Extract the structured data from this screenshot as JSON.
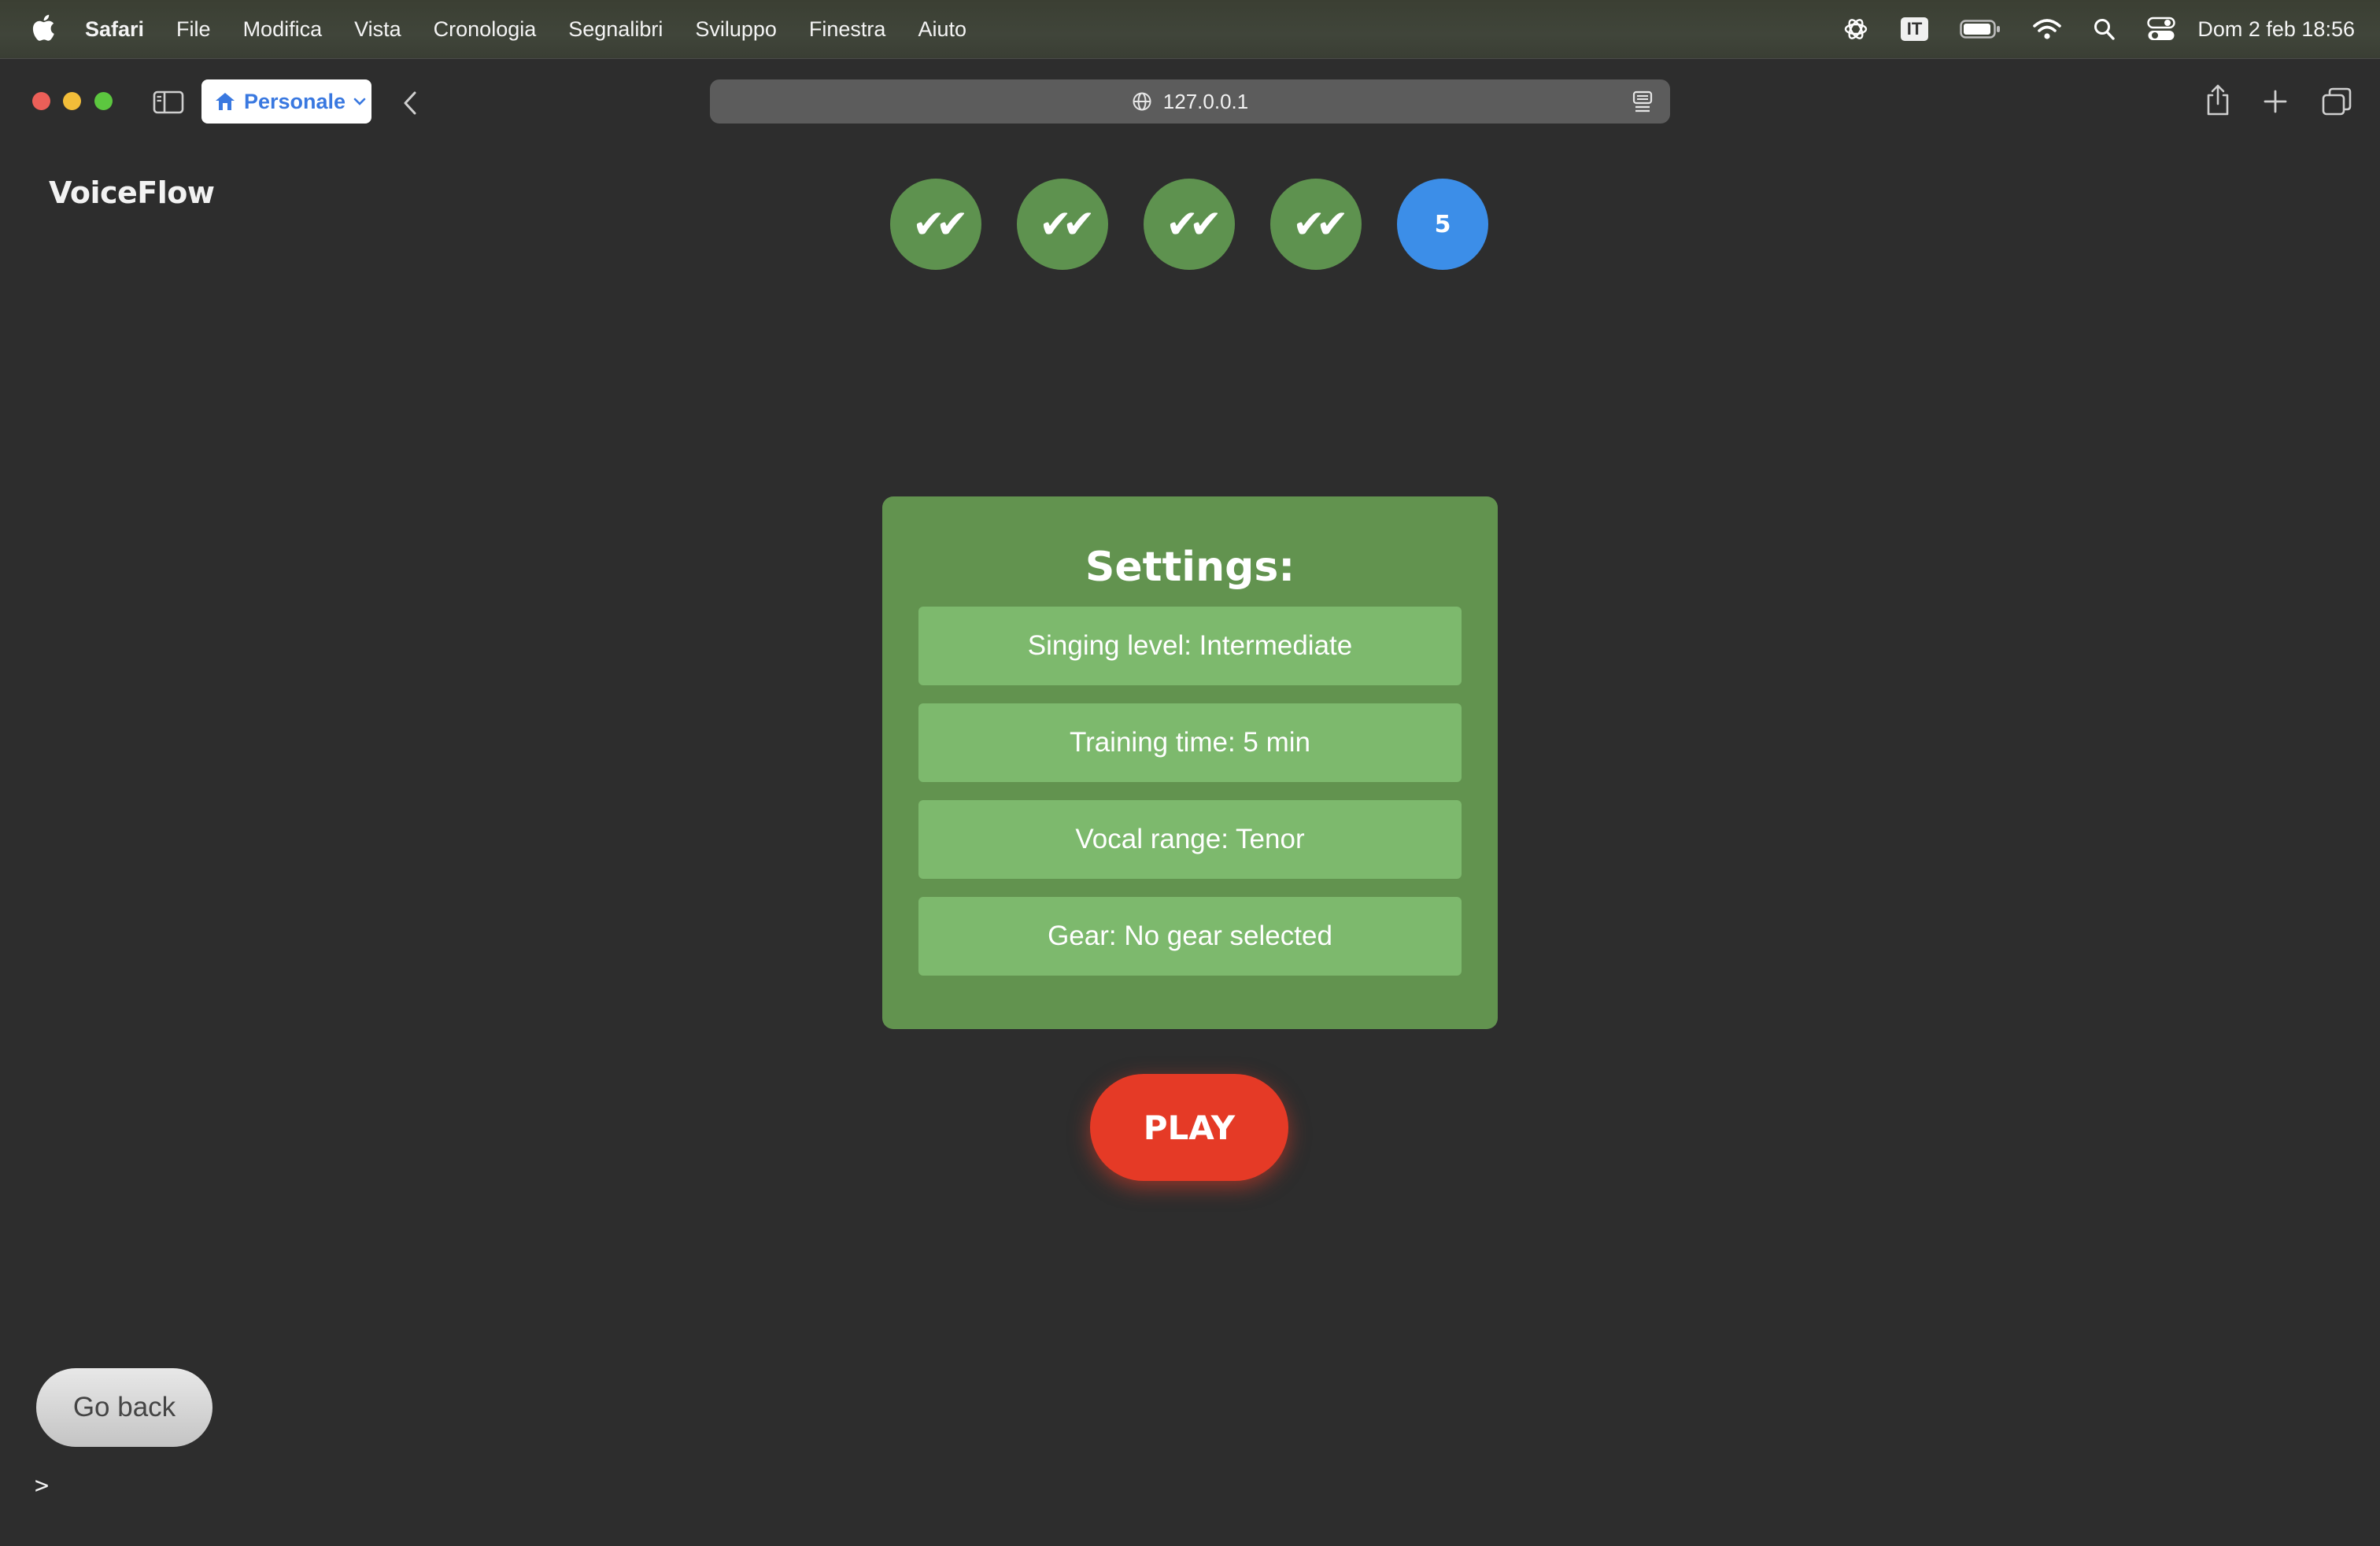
{
  "menubar": {
    "app_name": "Safari",
    "menus": [
      "File",
      "Modifica",
      "Vista",
      "Cronologia",
      "Segnalibri",
      "Sviluppo",
      "Finestra",
      "Aiuto"
    ],
    "input_source": "IT",
    "clock": "Dom 2 feb  18:56",
    "status_icons": [
      "chatgpt-icon",
      "input-source-icon",
      "battery-icon",
      "wifi-icon",
      "spotlight-icon",
      "control-center-icon"
    ]
  },
  "browser": {
    "profile_label": "Personale",
    "url": "127.0.0.1",
    "toolbar_icons": [
      "sidebar-toggle-icon",
      "back-arrow-icon",
      "globe-icon",
      "reader-icon",
      "share-icon",
      "new-tab-icon",
      "tab-overview-icon"
    ]
  },
  "app": {
    "logo": "VoiceFlow",
    "steps": [
      {
        "label": "✔✔",
        "state": "done"
      },
      {
        "label": "✔✔",
        "state": "done"
      },
      {
        "label": "✔✔",
        "state": "done"
      },
      {
        "label": "✔✔",
        "state": "done"
      },
      {
        "label": "5",
        "state": "current"
      }
    ],
    "settings": {
      "title": "Settings:",
      "singing_level": "Singing level: Intermediate",
      "training_time": "Training time: 5 min",
      "vocal_range": "Vocal range: Tenor",
      "gear": "Gear: No gear selected"
    },
    "play_label": "PLAY",
    "go_back_label": "Go back",
    "prompt": ">"
  },
  "colors": {
    "page_bg": "#2d2d2d",
    "step_done": "#5e924f",
    "step_current": "#3c8ee8",
    "card_bg": "#62934f",
    "setting_bg": "#7db96d",
    "play_bg": "#e53a26"
  }
}
